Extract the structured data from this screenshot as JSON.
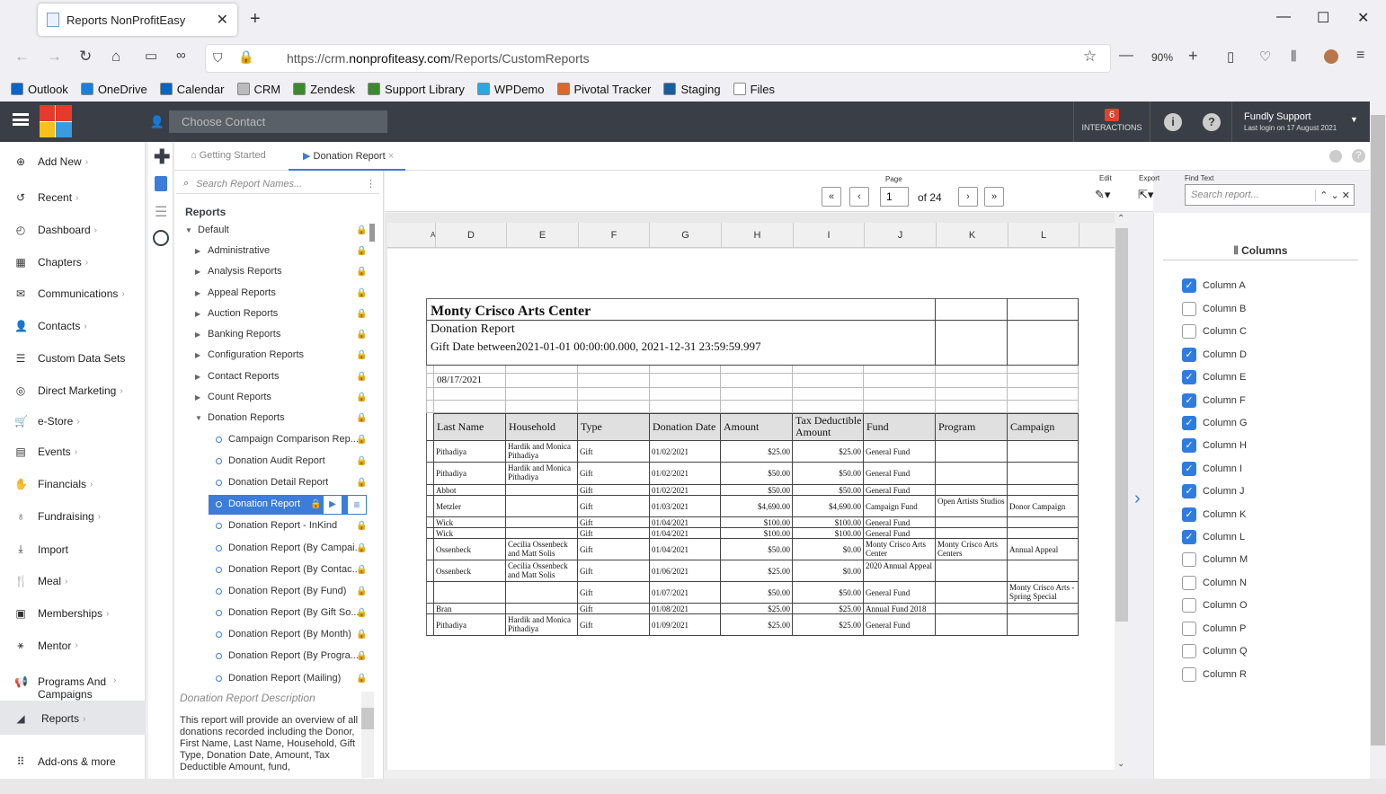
{
  "browser": {
    "tab_title": "Reports NonProfitEasy",
    "url_prefix": "https://crm.",
    "url_host": "nonprofiteasy.com",
    "url_path": "/Reports/CustomReports",
    "zoom": "90%"
  },
  "bookmarks": [
    {
      "label": "Outlook",
      "color": "#0a64c8"
    },
    {
      "label": "OneDrive",
      "color": "#1b7fe0"
    },
    {
      "label": "Calendar",
      "color": "#0a64c8"
    },
    {
      "label": "CRM",
      "color": "#bbbbbb"
    },
    {
      "label": "Zendesk",
      "color": "#3c8a2e"
    },
    {
      "label": "Support Library",
      "color": "#3c8a2e"
    },
    {
      "label": "WPDemo",
      "color": "#2aa9e0"
    },
    {
      "label": "Pivotal Tracker",
      "color": "#d9692c"
    },
    {
      "label": "Staging",
      "color": "#1a5d9c"
    },
    {
      "label": "Files",
      "color": "#ffffff"
    }
  ],
  "header": {
    "contact_placeholder": "Choose Contact",
    "interactions_count": "6",
    "interactions_label": "INTERACTIONS",
    "user_name": "Fundly Support",
    "last_login": "Last login on 17 August 2021"
  },
  "sidebar": [
    {
      "label": "Add New",
      "icon": "plus-circle-icon"
    },
    {
      "label": "Recent",
      "icon": "history-icon"
    },
    {
      "label": "Dashboard",
      "icon": "dashboard-icon"
    },
    {
      "label": "Chapters",
      "icon": "grid-icon"
    },
    {
      "label": "Communications",
      "icon": "mail-icon"
    },
    {
      "label": "Contacts",
      "icon": "person-icon"
    },
    {
      "label": "Custom Data Sets",
      "icon": "database-icon"
    },
    {
      "label": "Direct Marketing",
      "icon": "target-icon"
    },
    {
      "label": "e-Store",
      "icon": "cart-icon"
    },
    {
      "label": "Events",
      "icon": "calendar-icon"
    },
    {
      "label": "Financials",
      "icon": "handshake-icon"
    },
    {
      "label": "Fundraising",
      "icon": "piggy-icon"
    },
    {
      "label": "Import",
      "icon": "import-icon"
    },
    {
      "label": "Meal",
      "icon": "utensils-icon"
    },
    {
      "label": "Memberships",
      "icon": "card-icon"
    },
    {
      "label": "Mentor",
      "icon": "mentor-icon"
    },
    {
      "label": "Programs And Campaigns",
      "icon": "megaphone-icon"
    },
    {
      "label": "Reports",
      "icon": "chart-icon"
    },
    {
      "label": "Add-ons & more",
      "icon": "apps-icon"
    }
  ],
  "tabs": {
    "getting_started": "Getting Started",
    "donation_report": "Donation Report"
  },
  "tree": {
    "search_placeholder": "Search Report Names...",
    "heading": "Reports",
    "default": "Default",
    "folders": [
      "Administrative",
      "Analysis Reports",
      "Appeal Reports",
      "Auction Reports",
      "Banking Reports",
      "Configuration Reports",
      "Contact Reports",
      "Count Reports",
      "Donation Reports"
    ],
    "donation_items": [
      "Campaign Comparison Rep...",
      "Donation Audit Report",
      "Donation Detail Report",
      "Donation Report",
      "Donation Report - InKind",
      "Donation Report (By Campai...",
      "Donation Report (By Contac...",
      "Donation Report (By Fund)",
      "Donation Report (By Gift So...",
      "Donation Report (By Month)",
      "Donation Report (By Progra...",
      "Donation Report (Mailing)"
    ]
  },
  "description": {
    "title": "Donation Report Description",
    "text": "This report will provide an overview of all donations recorded including the Donor, First Name, Last Name, Household, Gift Type, Donation Date, Amount, Tax Deductible Amount, fund,"
  },
  "pager": {
    "label": "Page",
    "current": "1",
    "of": "of",
    "total": "24",
    "edit": "Edit",
    "export": "Export",
    "find_text": "Find Text",
    "find_placeholder": "Search report..."
  },
  "sheet_cols": [
    "A",
    "D",
    "E",
    "F",
    "G",
    "H",
    "I",
    "J",
    "K",
    "L"
  ],
  "report": {
    "org": "Monty Crisco Arts Center",
    "name": "Donation Report",
    "criteria": "Gift Date between2021-01-01 00:00:00.000, 2021-12-31 23:59:59.997",
    "date": "08/17/2021",
    "headers": [
      "Last Name",
      "Household",
      "Type",
      "Donation Date",
      "Amount",
      "Tax Deductible Amount",
      "Fund",
      "Program",
      "Campaign"
    ],
    "rows": [
      [
        "Pithadiya",
        "Hardik and Monica Pithadiya",
        "Gift",
        "01/02/2021",
        "$25.00",
        "$25.00",
        "General Fund",
        "",
        ""
      ],
      [
        "Pithadiya",
        "Hardik and Monica Pithadiya",
        "Gift",
        "01/02/2021",
        "$50.00",
        "$50.00",
        "General Fund",
        "",
        ""
      ],
      [
        "Abbot",
        "",
        "Gift",
        "01/02/2021",
        "$50.00",
        "$50.00",
        "General Fund",
        "",
        ""
      ],
      [
        "Metzler",
        "",
        "Gift",
        "01/03/2021",
        "$4,690.00",
        "$4,690.00",
        "Campaign Fund",
        "Open Artists Studios",
        "Donor Campaign"
      ],
      [
        "Wick",
        "",
        "Gift",
        "01/04/2021",
        "$100.00",
        "$100.00",
        "General Fund",
        "",
        ""
      ],
      [
        "Wick",
        "",
        "Gift",
        "01/04/2021",
        "$100.00",
        "$100.00",
        "General Fund",
        "",
        ""
      ],
      [
        "Ossenbeck",
        "Cecilia Ossenbeck and Matt Solis",
        "Gift",
        "01/04/2021",
        "$50.00",
        "$0.00",
        "Monty Crisco Arts Center",
        "Monty Crisco Arts Centers",
        "Annual Appeal"
      ],
      [
        "Ossenbeck",
        "Cecilia Ossenbeck and Matt Solis",
        "Gift",
        "01/06/2021",
        "$25.00",
        "$0.00",
        "2020 Annual Appeal",
        "",
        ""
      ],
      [
        "",
        "",
        "Gift",
        "01/07/2021",
        "$50.00",
        "$50.00",
        "General Fund",
        "",
        "Monty Crisco Arts - Spring Special"
      ],
      [
        "Bran",
        "",
        "Gift",
        "01/08/2021",
        "$25.00",
        "$25.00",
        "Annual Fund 2018",
        "",
        ""
      ],
      [
        "Pithadiya",
        "Hardik and Monica Pithadiya",
        "Gift",
        "01/09/2021",
        "$25.00",
        "$25.00",
        "General Fund",
        "",
        ""
      ]
    ]
  },
  "columns_panel": {
    "title": "Columns",
    "items": [
      {
        "label": "Column A",
        "checked": true
      },
      {
        "label": "Column B",
        "checked": false
      },
      {
        "label": "Column C",
        "checked": false
      },
      {
        "label": "Column D",
        "checked": true
      },
      {
        "label": "Column E",
        "checked": true
      },
      {
        "label": "Column F",
        "checked": true
      },
      {
        "label": "Column G",
        "checked": true
      },
      {
        "label": "Column H",
        "checked": true
      },
      {
        "label": "Column I",
        "checked": true
      },
      {
        "label": "Column J",
        "checked": true
      },
      {
        "label": "Column K",
        "checked": true
      },
      {
        "label": "Column L",
        "checked": true
      },
      {
        "label": "Column M",
        "checked": false
      },
      {
        "label": "Column N",
        "checked": false
      },
      {
        "label": "Column O",
        "checked": false
      },
      {
        "label": "Column P",
        "checked": false
      },
      {
        "label": "Column Q",
        "checked": false
      },
      {
        "label": "Column R",
        "checked": false
      }
    ]
  }
}
